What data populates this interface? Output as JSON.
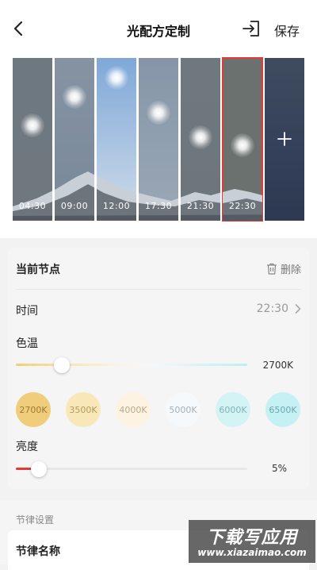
{
  "header": {
    "title": "光配方定制",
    "save_label": "保存",
    "back_icon": "back-arrow-icon",
    "export_icon": "export-icon"
  },
  "nodes": [
    {
      "time": "04:30",
      "sky_top": "#6e7880",
      "sky_bottom": "#6f787f",
      "selected": false
    },
    {
      "time": "09:00",
      "sky_top": "#8593a3",
      "sky_bottom": "#79889a",
      "selected": false
    },
    {
      "time": "12:00",
      "sky_top": "#7fa8d8",
      "sky_bottom": "#cfdcea",
      "selected": false
    },
    {
      "time": "17:30",
      "sky_top": "#8696a8",
      "sky_bottom": "#9aa8b6",
      "selected": false
    },
    {
      "time": "21:30",
      "sky_top": "#6f787e",
      "sky_bottom": "#6d767c",
      "selected": false
    },
    {
      "time": "22:30",
      "sky_top": "#6a716e",
      "sky_bottom": "#6a716e",
      "selected": true
    }
  ],
  "current_node": {
    "title": "当前节点",
    "delete_label": "删除",
    "time_label": "时间",
    "time_value": "22:30",
    "color_temp_label": "色温",
    "color_temp_value": "2700K",
    "color_temp_level": 0.2,
    "presets": [
      {
        "label": "2700K",
        "bg": "#f0cd7a",
        "fg": "#9a7a35"
      },
      {
        "label": "3500K",
        "bg": "#f8e7b8",
        "fg": "#b49a5e"
      },
      {
        "label": "4000K",
        "bg": "#fcf3e2",
        "fg": "#b9a98a"
      },
      {
        "label": "5000K",
        "bg": "#f6f9fb",
        "fg": "#a7b0b8"
      },
      {
        "label": "6000K",
        "bg": "#d3f3f4",
        "fg": "#7fb3b7"
      },
      {
        "label": "6500K",
        "bg": "#c6f1f4",
        "fg": "#6aa7ad"
      }
    ],
    "brightness_label": "亮度",
    "brightness_value": "5%",
    "brightness_level": 0.05
  },
  "rhythm": {
    "section_title": "节律设置",
    "name_label": "节律名称"
  },
  "watermark": {
    "main": "下载写应用",
    "url": "www.xiazaimao.com"
  },
  "colors": {
    "accent": "#e53935"
  }
}
